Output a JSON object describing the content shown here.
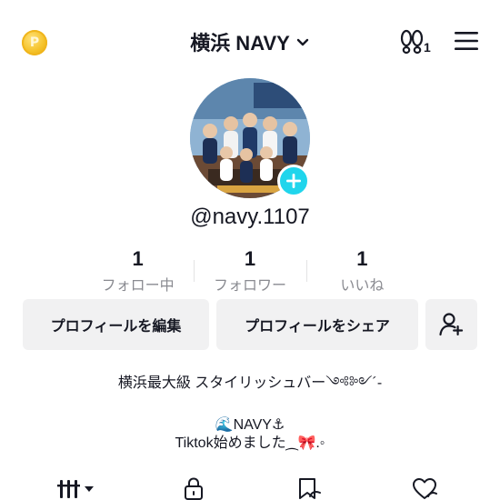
{
  "header": {
    "coin_glyph": "P",
    "title": "横浜 NAVY",
    "footprint_count": "1",
    "icons": [
      "coin-icon",
      "chevron-down-icon",
      "footprint-icon",
      "hamburger-menu-icon"
    ]
  },
  "profile": {
    "username": "@navy.1107",
    "avatar_icon": "avatar-photo",
    "add_icon": "plus-icon"
  },
  "stats": [
    {
      "value": "1",
      "label": "フォロー中"
    },
    {
      "value": "1",
      "label": "フォロワー"
    },
    {
      "value": "1",
      "label": "いいね"
    }
  ],
  "actions": {
    "edit_label": "プロフィールを編集",
    "share_label": "プロフィールをシェア",
    "add_friend_icon": "add-person-icon"
  },
  "bio": {
    "line1": "横浜最大級 スタイリッシュバー༺༻´-",
    "line2": "🌊NAVY⚓",
    "line3": "Tiktok始めました⁔🎀.◦"
  },
  "tabs": [
    "videos-grid-icon",
    "lock-icon",
    "saved-icon",
    "liked-icon"
  ],
  "colors": {
    "accent": "#20d5ec",
    "coin": "#f5c22a",
    "text": "#161823",
    "muted": "#8a8b91",
    "button_bg": "#f1f1f2"
  }
}
